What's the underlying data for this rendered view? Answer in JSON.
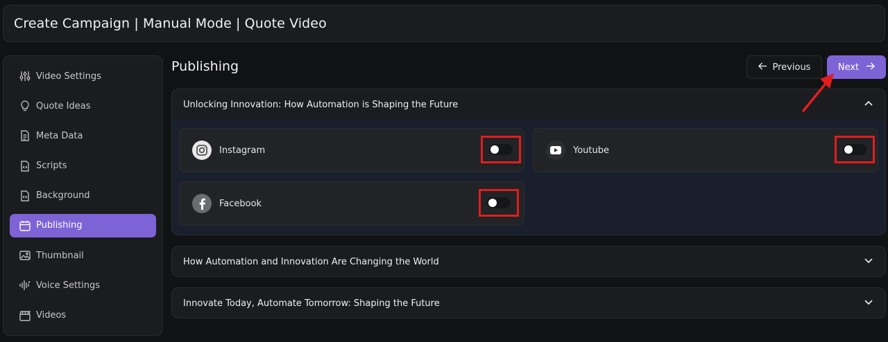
{
  "header": {
    "title": "Create Campaign | Manual Mode | Quote Video"
  },
  "sidebar": {
    "items": [
      {
        "label": "Video Settings",
        "icon": "sliders-icon",
        "active": false
      },
      {
        "label": "Quote Ideas",
        "icon": "lightbulb-icon",
        "active": false
      },
      {
        "label": "Meta Data",
        "icon": "document-icon",
        "active": false
      },
      {
        "label": "Scripts",
        "icon": "code-file-icon",
        "active": false
      },
      {
        "label": "Background",
        "icon": "code-file-icon",
        "active": false
      },
      {
        "label": "Publishing",
        "icon": "calendar-icon",
        "active": true
      },
      {
        "label": "Thumbnail",
        "icon": "image-icon",
        "active": false
      },
      {
        "label": "Voice Settings",
        "icon": "waveform-icon",
        "active": false
      },
      {
        "label": "Videos",
        "icon": "clapperboard-icon",
        "active": false
      }
    ]
  },
  "main": {
    "title": "Publishing",
    "prev_label": "Previous",
    "next_label": "Next",
    "accordions": [
      {
        "title": "Unlocking Innovation: How Automation is Shaping the Future",
        "expanded": true,
        "platforms": [
          {
            "name": "Instagram",
            "icon": "instagram-icon",
            "enabled": false
          },
          {
            "name": "Youtube",
            "icon": "youtube-icon",
            "enabled": false
          },
          {
            "name": "Facebook",
            "icon": "facebook-icon",
            "enabled": false
          }
        ]
      },
      {
        "title": "How Automation and Innovation Are Changing the World",
        "expanded": false
      },
      {
        "title": "Innovate Today, Automate Tomorrow: Shaping the Future",
        "expanded": false
      }
    ]
  },
  "colors": {
    "accent": "#7e63d6",
    "background": "#111214",
    "panel": "#1b1c1f",
    "highlight_box": "#e01e1e",
    "arrow": "#e01e1e"
  }
}
